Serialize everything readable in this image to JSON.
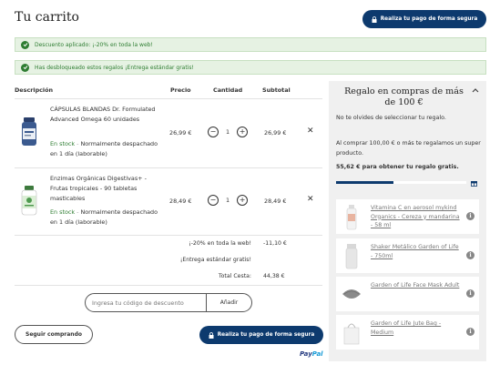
{
  "header": {
    "title": "Tu carrito",
    "pay_button": "Realiza tu pago de forma segura"
  },
  "banners": [
    {
      "text": "Descuento aplicado: ¡-20% en toda la web!"
    },
    {
      "text": "Has desbloqueado estos regalos ¡Entrega estándar gratis!"
    }
  ],
  "table": {
    "headers": {
      "description": "Descripción",
      "price": "Precio",
      "quantity": "Cantidad",
      "subtotal": "Subtotal"
    },
    "items": [
      {
        "name": "CÁPSULAS BLANDAS Dr. Formulated Advanced Omega 60 unidades",
        "stock": "En stock",
        "delivery": "Normalmente despachado en 1 día (laborable)",
        "price": "26,99 €",
        "qty": "1",
        "subtotal": "26,99 €"
      },
      {
        "name": "Enzimas Orgánicas Digestivas+ - Frutas tropicales - 90 tabletas masticables",
        "stock": "En stock",
        "delivery": "Normalmente despachado en 1 día (laborable)",
        "price": "28,49 €",
        "qty": "1",
        "subtotal": "28,49 €"
      }
    ]
  },
  "summary": {
    "discount_label": "¡-20% en toda la web!",
    "discount_value": "-11,10 €",
    "shipping_label": "¡Entrega estándar gratis!",
    "shipping_value": "",
    "total_label": "Total Cesta:",
    "total_value": "44,38 €"
  },
  "coupon": {
    "placeholder": "Ingresa tu código de descuento",
    "apply": "Añadir"
  },
  "footer": {
    "continue": "Seguir comprando",
    "pay_button": "Realiza tu pago de forma segura",
    "paypal_pay": "Pay",
    "paypal_pal": "Pal"
  },
  "gift_panel": {
    "title": "Regalo en compras de más de 100 €",
    "reminder": "No te olvides de seleccionar tu regalo.",
    "promo": "Al comprar 100,00 € o más te regalamos un super producto.",
    "remaining": "55,62 € para obtener tu regalo gratis.",
    "progress": 0.44,
    "gifts": [
      {
        "name": "Vitamina C en aerosol mykind Organics - Cereza y mandarina - 58 ml"
      },
      {
        "name": "Shaker Metálico Garden of Life - 750ml"
      },
      {
        "name": "Garden of Life Face Mask Adult"
      },
      {
        "name": "Garden of Life Jute Bag - Medium"
      }
    ]
  },
  "colors": {
    "primary": "#0d3a6e",
    "success": "#2e7d32",
    "success_bg": "#e6f2e3",
    "panel_bg": "#f0f0f0"
  }
}
